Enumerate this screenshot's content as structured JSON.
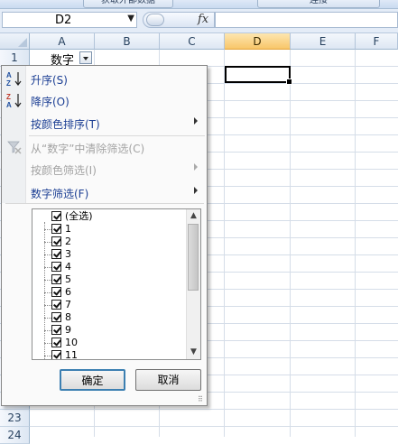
{
  "ribbon": {
    "button_left": "获取外部数据",
    "button_right": "连接"
  },
  "formula_bar": {
    "name_box": "D2",
    "fx_label": "fx",
    "formula": ""
  },
  "columns": [
    "A",
    "B",
    "C",
    "D",
    "E",
    "F"
  ],
  "selected_column": "D",
  "rows": [
    "1",
    "23",
    "24"
  ],
  "cell_a1": "数字",
  "menu": {
    "items": [
      {
        "label": "升序(S)",
        "enabled": true
      },
      {
        "label": "降序(O)",
        "enabled": true
      },
      {
        "label": "按颜色排序(T)",
        "enabled": true,
        "submenu": true
      },
      {
        "label": "从“数字”中清除筛选(C)",
        "enabled": false
      },
      {
        "label": "按颜色筛选(I)",
        "enabled": false,
        "submenu": true
      },
      {
        "label": "数字筛选(F)",
        "enabled": true,
        "submenu": true
      }
    ],
    "list": [
      "(全选)",
      "1",
      "2",
      "3",
      "4",
      "5",
      "6",
      "7",
      "8",
      "9",
      "10",
      "11"
    ],
    "ok_label": "确定",
    "cancel_label": "取消"
  },
  "icons": {
    "sort_asc": "sort-ascending-icon",
    "sort_desc": "sort-descending-icon",
    "clear_filter": "clear-filter-icon"
  }
}
